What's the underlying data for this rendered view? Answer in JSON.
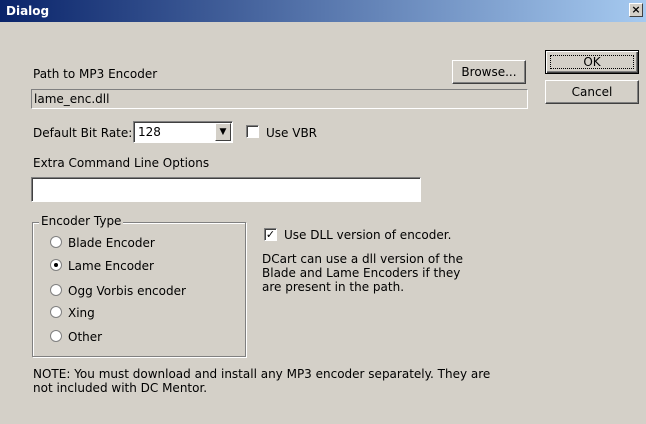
{
  "window": {
    "title": "Dialog",
    "close_glyph": "×"
  },
  "buttons": {
    "ok": "OK",
    "cancel": "Cancel",
    "browse": "Browse..."
  },
  "encoder_path": {
    "label": "Path to MP3 Encoder",
    "value": "lame_enc.dll"
  },
  "bitrate": {
    "label": "Default Bit Rate:",
    "value": "128",
    "dropdown_icon": "chevron-down-icon"
  },
  "vbr": {
    "label": "Use VBR",
    "checked": false
  },
  "extra_options": {
    "label": "Extra Command Line Options",
    "value": ""
  },
  "encoder_type": {
    "label": "Encoder Type",
    "options": [
      {
        "label": "Blade Encoder",
        "selected": false
      },
      {
        "label": "Lame Encoder",
        "selected": true
      },
      {
        "label": "Ogg Vorbis encoder",
        "selected": false
      },
      {
        "label": "Xing",
        "selected": false
      },
      {
        "label": "Other",
        "selected": false
      }
    ]
  },
  "dll": {
    "label": "Use DLL version of encoder.",
    "checked": true,
    "check_glyph": "✓",
    "description_lines": [
      "DCart can use a dll version of the",
      "Blade and Lame Encoders if they",
      "are present in the path."
    ]
  },
  "note": {
    "lines": [
      "NOTE: You must download and install any MP3 encoder separately.  They are",
      "not included with DC Mentor."
    ]
  }
}
